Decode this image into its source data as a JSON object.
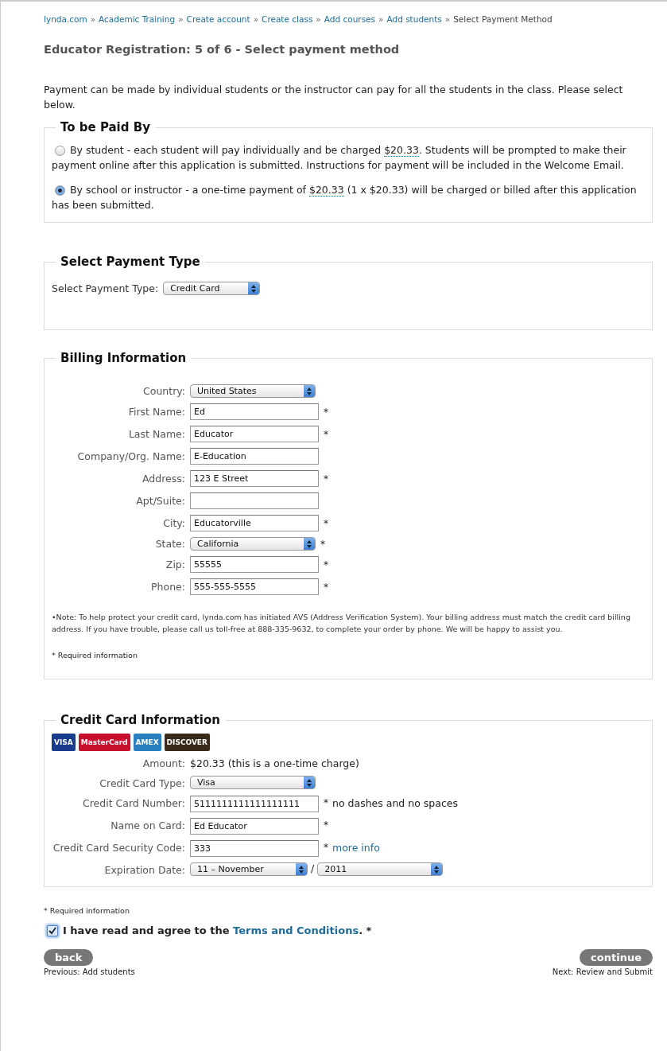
{
  "breadcrumb": [
    {
      "label": "lynda.com",
      "link": true
    },
    {
      "label": "Academic Training",
      "link": true
    },
    {
      "label": "Create account",
      "link": true
    },
    {
      "label": "Create class",
      "link": true
    },
    {
      "label": "Add courses",
      "link": true
    },
    {
      "label": "Add students",
      "link": true
    },
    {
      "label": "Select Payment Method",
      "link": false
    }
  ],
  "breadcrumb_separator": "»",
  "title": "Educator Registration: 5 of 6 - Select payment method",
  "intro": "Payment can be made by individual students or the instructor can pay for all the students in the class. Please select below.",
  "paid_by": {
    "legend": "To be Paid By",
    "options": [
      {
        "before": "By student - each student will pay individually and be charged ",
        "amount": "$20.33",
        "after": ". Students will be prompted to make their payment online after this application is submitted. Instructions for payment will be included in the Welcome Email.",
        "selected": false
      },
      {
        "before": "By school or instructor - a one-time payment of ",
        "amount": "$20.33",
        "after": " (1 x $20.33) will be charged or billed after this application has been submitted.",
        "selected": true
      }
    ]
  },
  "payment_type": {
    "legend": "Select Payment Type",
    "label": "Select Payment Type:",
    "value": "Credit Card"
  },
  "billing": {
    "legend": "Billing Information",
    "fields": [
      {
        "kind": "select",
        "label": "Country:",
        "value": "United States",
        "required": false
      },
      {
        "kind": "text",
        "label": "First Name:",
        "value": "Ed",
        "required": true
      },
      {
        "kind": "text",
        "label": "Last Name:",
        "value": "Educator",
        "required": true
      },
      {
        "kind": "text",
        "label": "Company/Org. Name:",
        "value": "E-Education",
        "required": false
      },
      {
        "kind": "text",
        "label": "Address:",
        "value": "123 E Street",
        "required": true
      },
      {
        "kind": "text",
        "label": "Apt/Suite:",
        "required": false
      },
      {
        "kind": "text",
        "label": "City:",
        "value": "Educatorville",
        "required": true
      },
      {
        "kind": "select",
        "label": "State:",
        "value": "California",
        "required": true
      },
      {
        "kind": "text",
        "label": "Zip:",
        "value": "55555",
        "required": true
      },
      {
        "kind": "text",
        "label": "Phone:",
        "value": "555-555-5555",
        "required": true
      }
    ],
    "note": "•Note: To help protect your credit card, lynda.com has initiated AVS (Address Verification System). Your billing address must match the credit card billing address. If you have trouble, please call us toll-free at 888-335-9632, to complete your order by phone. We will be happy to assist you.",
    "required_note": "* Required information"
  },
  "credit_card": {
    "legend": "Credit Card Information",
    "logos": [
      {
        "label": "VISA",
        "color": "#1a3c8c"
      },
      {
        "label": "MasterCard",
        "color": "#c8102e"
      },
      {
        "label": "AMEX",
        "color": "#2a7fc0"
      },
      {
        "label": "DISCOVER",
        "color": "#3a2a1a"
      }
    ],
    "fields": [
      {
        "kind": "static",
        "label": "Amount:",
        "value": "$20.33 (this is a one-time charge)"
      },
      {
        "kind": "select",
        "label": "Credit Card Type:",
        "value": "Visa"
      },
      {
        "kind": "text",
        "label": "Credit Card Number:",
        "value": "5111111111111111111",
        "required": true,
        "hint": "no dashes and no spaces"
      },
      {
        "kind": "text",
        "label": "Name on Card:",
        "value": "Ed Educator",
        "required": true
      },
      {
        "kind": "text",
        "label": "Credit Card Security Code:",
        "value": "333",
        "required": true,
        "link": "more info"
      },
      {
        "kind": "date",
        "label": "Expiration Date:",
        "month": "11 – November",
        "separator": "/",
        "year": "2011"
      }
    ]
  },
  "required_note": "* Required information",
  "required_mark": "*",
  "agree": {
    "checked": true,
    "before": "I have read and agree to the ",
    "link": "Terms and Conditions",
    "after": ". *"
  },
  "back": {
    "label": "back",
    "caption": "Previous: Add students"
  },
  "continue": {
    "label": "continue",
    "caption": "Next: Review and Submit"
  }
}
